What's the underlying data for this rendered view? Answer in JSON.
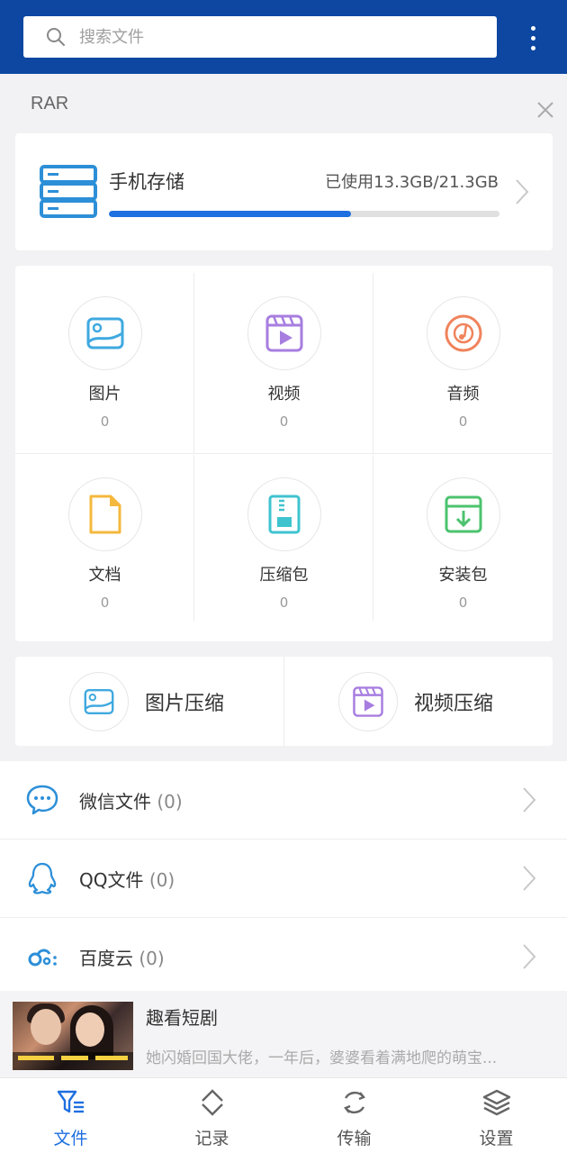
{
  "search": {
    "placeholder": "搜索文件"
  },
  "section_label": "RAR",
  "storage": {
    "title": "手机存储",
    "used_text": "已使用13.3GB/21.3GB",
    "progress_fraction": 0.62
  },
  "categories": [
    {
      "label": "图片",
      "count": "0",
      "icon": "image-icon",
      "color": "#3fa9e0"
    },
    {
      "label": "视频",
      "count": "0",
      "icon": "video-icon",
      "color": "#a77ee0"
    },
    {
      "label": "音频",
      "count": "0",
      "icon": "audio-icon",
      "color": "#f0835c"
    },
    {
      "label": "文档",
      "count": "0",
      "icon": "document-icon",
      "color": "#f4b83c"
    },
    {
      "label": "压缩包",
      "count": "0",
      "icon": "archive-icon",
      "color": "#3fc3cf"
    },
    {
      "label": "安装包",
      "count": "0",
      "icon": "install-package-icon",
      "color": "#4cc36e"
    }
  ],
  "compress": [
    {
      "label": "图片压缩",
      "icon": "image-compress-icon"
    },
    {
      "label": "视频压缩",
      "icon": "video-compress-icon"
    }
  ],
  "sources": [
    {
      "label": "微信文件",
      "count": "(0)",
      "icon": "wechat-icon"
    },
    {
      "label": "QQ文件",
      "count": "(0)",
      "icon": "qq-icon"
    },
    {
      "label": "百度云",
      "count": "(0)",
      "icon": "baidu-cloud-icon"
    }
  ],
  "ad": {
    "title": "趣看短剧",
    "description": "她闪婚回国大佬，一年后，婆婆看着满地爬的萌宝..."
  },
  "nav": [
    {
      "label": "文件",
      "icon": "file-filter-icon",
      "active": true
    },
    {
      "label": "记录",
      "icon": "record-icon",
      "active": false
    },
    {
      "label": "传输",
      "icon": "transfer-icon",
      "active": false
    },
    {
      "label": "设置",
      "icon": "layers-icon",
      "active": false
    }
  ],
  "colors": {
    "header": "#0d47a1",
    "accent": "#1e6fe0",
    "icon_blue": "#2d8fd8"
  }
}
